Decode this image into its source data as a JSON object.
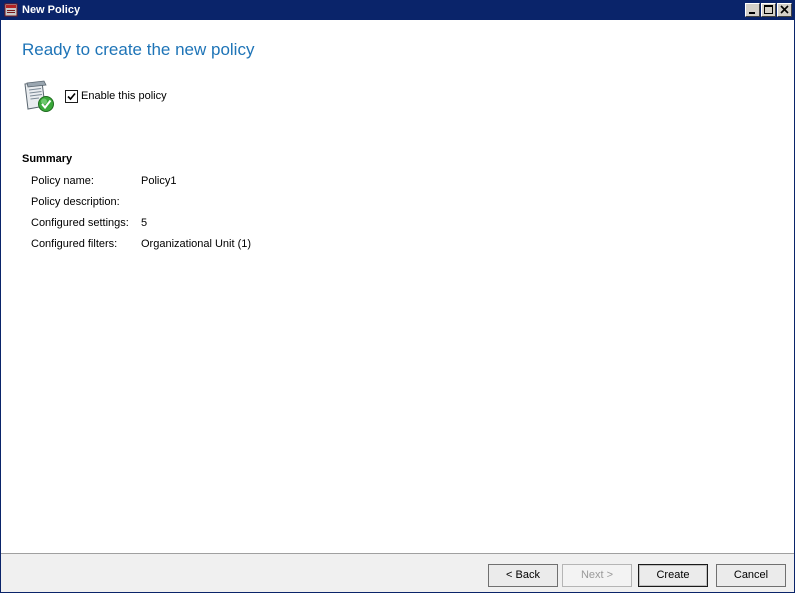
{
  "window": {
    "title": "New Policy"
  },
  "main": {
    "heading": "Ready to create the new policy",
    "enable_checkbox": {
      "label": "Enable this policy",
      "checked": true
    }
  },
  "summary": {
    "title": "Summary",
    "rows": [
      {
        "label": "Policy name:",
        "value": "Policy1"
      },
      {
        "label": "Policy description:",
        "value": ""
      },
      {
        "label": "Configured settings:",
        "value": "5"
      },
      {
        "label": "Configured filters:",
        "value": "Organizational Unit (1)"
      }
    ]
  },
  "footer": {
    "back_label": "< Back",
    "next_label": "Next >",
    "create_label": "Create",
    "cancel_label": "Cancel"
  },
  "colors": {
    "heading": "#1e74b7",
    "titlebar": "#0a246a"
  }
}
